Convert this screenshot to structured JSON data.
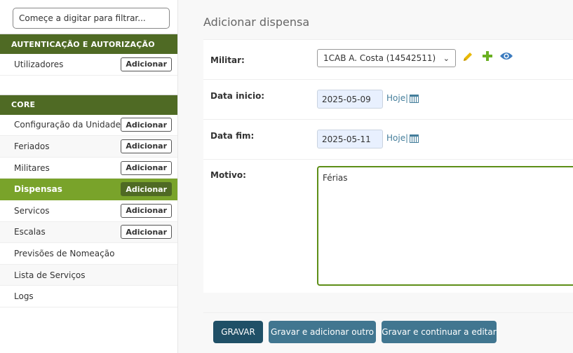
{
  "filter": {
    "placeholder": "Começe a digitar para filtrar..."
  },
  "sidebar": {
    "auth": {
      "header": "AUTENTICAÇÃO E AUTORIZAÇÃO",
      "items": [
        {
          "label": "Utilizadores",
          "add": "Adicionar"
        }
      ]
    },
    "core": {
      "header": "CORE",
      "items": [
        {
          "label": "Configuração da Unidade",
          "add": "Adicionar"
        },
        {
          "label": "Feriados",
          "add": "Adicionar"
        },
        {
          "label": "Militares",
          "add": "Adicionar"
        },
        {
          "label": "Dispensas",
          "add": "Adicionar"
        },
        {
          "label": "Servicos",
          "add": "Adicionar"
        },
        {
          "label": "Escalas",
          "add": "Adicionar"
        },
        {
          "label": "Previsões de Nomeação"
        },
        {
          "label": "Lista de Serviços"
        },
        {
          "label": "Logs"
        }
      ]
    }
  },
  "main": {
    "title": "Adicionar dispensa",
    "militar": {
      "label": "Militar:",
      "value": "1CAB A. Costa (14542511)"
    },
    "data_inicio": {
      "label": "Data inicio:",
      "value": "2025-05-09",
      "today": "Hoje",
      "sep": "|"
    },
    "data_fim": {
      "label": "Data fim:",
      "value": "2025-05-11",
      "today": "Hoje",
      "sep": "|"
    },
    "motivo": {
      "label": "Motivo:",
      "value": "Férias"
    }
  },
  "buttons": {
    "save": "GRAVAR",
    "save_add": "Gravar e adicionar outro",
    "save_continue": "Gravar e continuar a editar"
  },
  "colors": {
    "module_header": "#4f6a24",
    "active_row": "#79a32a",
    "primary_button": "#205067",
    "secondary_button": "#417690",
    "edit_icon": "#e8b800",
    "add_icon": "#6ab022",
    "view_icon": "#3b7bbf"
  },
  "icons": [
    "pencil-icon",
    "plus-icon",
    "eye-icon",
    "calendar-icon",
    "chevron-down-icon"
  ]
}
